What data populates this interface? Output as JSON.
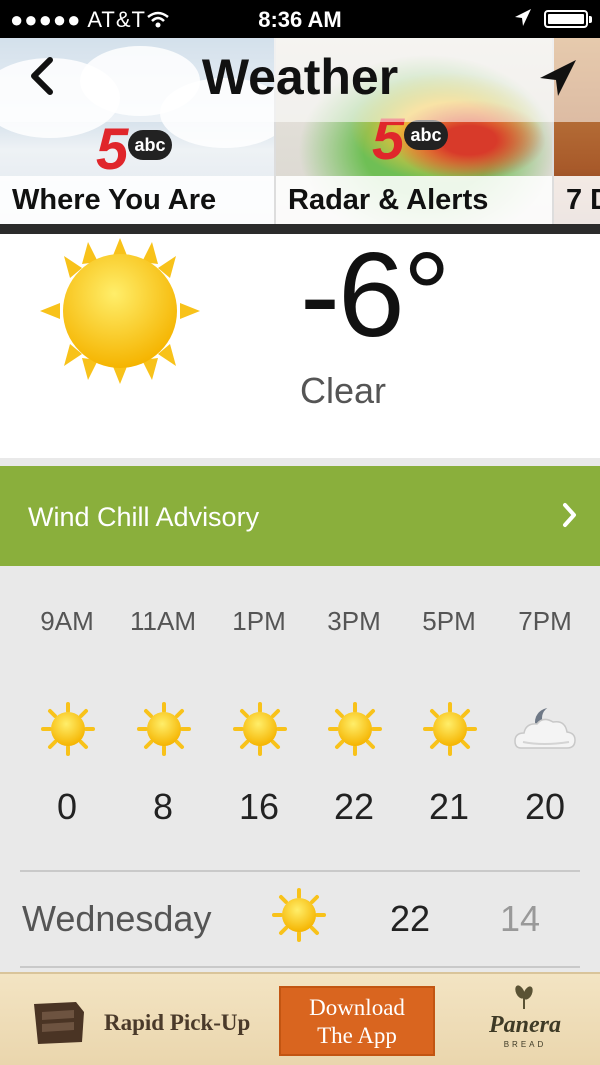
{
  "status_bar": {
    "carrier": "●●●●● AT&T",
    "time": "8:36 AM"
  },
  "header": {
    "title": "Weather"
  },
  "tiles": [
    {
      "label": "Where You Are",
      "logo_number": "5",
      "logo_network": "abc"
    },
    {
      "label": "Radar & Alerts",
      "logo_number": "5",
      "logo_network": "abc"
    },
    {
      "label": "7 D"
    }
  ],
  "current": {
    "temperature": "-6°",
    "condition": "Clear",
    "icon": "sun-icon"
  },
  "advisory": {
    "label": "Wind Chill Advisory",
    "color": "#8aaf3c"
  },
  "hourly": [
    {
      "time": "9AM",
      "value": "0",
      "icon": "sun-icon"
    },
    {
      "time": "11AM",
      "value": "8",
      "icon": "sun-icon"
    },
    {
      "time": "1PM",
      "value": "16",
      "icon": "sun-icon"
    },
    {
      "time": "3PM",
      "value": "22",
      "icon": "sun-icon"
    },
    {
      "time": "5PM",
      "value": "21",
      "icon": "sun-icon"
    },
    {
      "time": "7PM",
      "value": "20",
      "icon": "moon-cloud-icon"
    }
  ],
  "daily": [
    {
      "day": "Wednesday",
      "high": "22",
      "low": "14",
      "icon": "sun-icon"
    }
  ],
  "ad": {
    "left_text": "Rapid Pick-Up",
    "button_line1": "Download",
    "button_line2": "The App",
    "brand": "Panera",
    "brand_sub": "BREAD"
  }
}
